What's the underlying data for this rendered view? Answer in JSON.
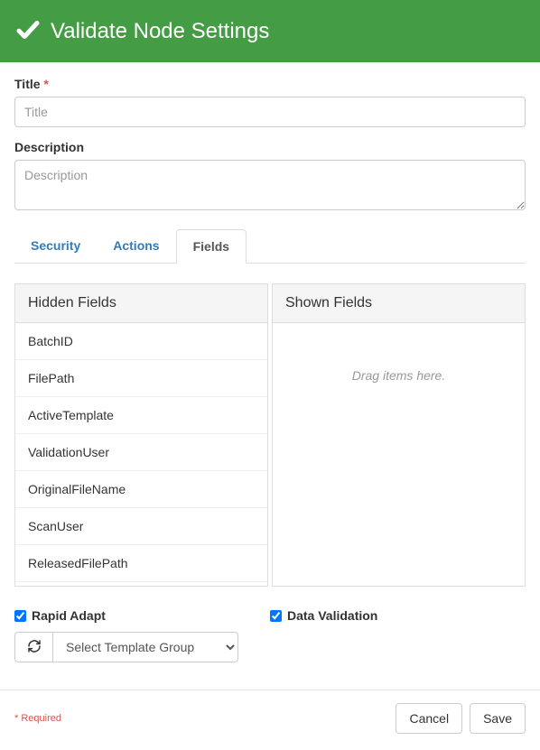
{
  "header": {
    "title": "Validate Node Settings"
  },
  "form": {
    "title_label": "Title",
    "title_placeholder": "Title",
    "title_value": "",
    "description_label": "Description",
    "description_placeholder": "Description",
    "description_value": ""
  },
  "tabs": [
    {
      "label": "Security",
      "active": false
    },
    {
      "label": "Actions",
      "active": false
    },
    {
      "label": "Fields",
      "active": true
    }
  ],
  "fields_panel": {
    "hidden_header": "Hidden Fields",
    "shown_header": "Shown Fields",
    "hidden_items": [
      "BatchID",
      "FilePath",
      "ActiveTemplate",
      "ValidationUser",
      "OriginalFileName",
      "ScanUser",
      "ReleasedFilePath"
    ],
    "shown_empty_text": "Drag items here."
  },
  "options": {
    "rapid_adapt_label": "Rapid Adapt",
    "rapid_adapt_checked": true,
    "data_validation_label": "Data Validation",
    "data_validation_checked": true,
    "template_select_placeholder": "Select Template Group"
  },
  "footer": {
    "required_note": "* Required",
    "cancel": "Cancel",
    "save": "Save"
  }
}
